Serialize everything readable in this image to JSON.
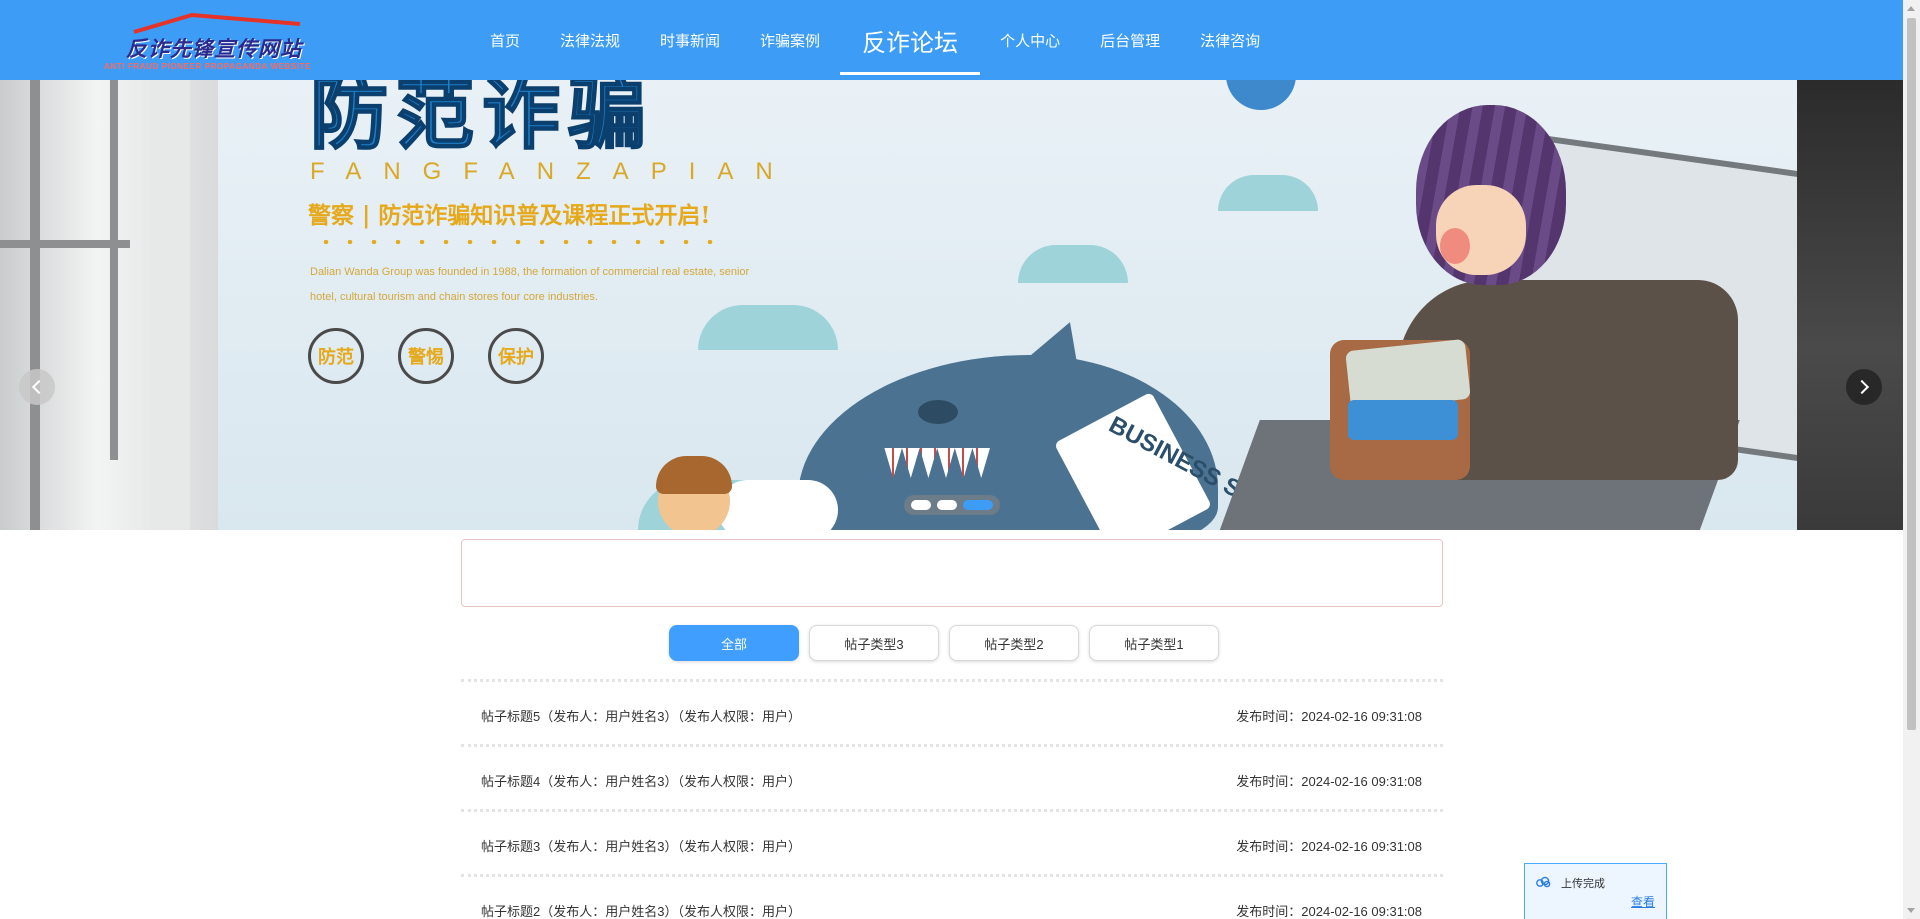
{
  "logo": {
    "title": "反诈先锋宣传网站",
    "subtitle": "ANTI FRAUD PIONEER PROPAGANDA WEBSITE"
  },
  "nav": {
    "items": [
      {
        "label": "首页"
      },
      {
        "label": "法律法规"
      },
      {
        "label": "时事新闻"
      },
      {
        "label": "诈骗案例"
      },
      {
        "label": "反诈论坛",
        "active": true
      },
      {
        "label": "个人中心"
      },
      {
        "label": "后台管理"
      },
      {
        "label": "法律咨询"
      }
    ]
  },
  "banner": {
    "spelling": "FANGFANZAPIAN",
    "slogan": "警察 | 防范诈骗知识普及课程正式开启!",
    "english_line1": "Dalian Wanda Group was founded in 1988, the formation of commercial real estate, senior",
    "english_line2": "hotel, cultural tourism and chain stores four core industries.",
    "badges": [
      "防范",
      "警惕",
      "保护"
    ],
    "shark_label": "BUSINESS SHARK",
    "active_slide": 3,
    "slide_count": 3
  },
  "filter_tabs": [
    {
      "label": "全部",
      "active": true
    },
    {
      "label": "帖子类型3"
    },
    {
      "label": "帖子类型2"
    },
    {
      "label": "帖子类型1"
    }
  ],
  "posts": [
    {
      "title": "帖子标题5（发布人：用户姓名3）（发布人权限：用户）",
      "time": "发布时间：2024-02-16 09:31:08"
    },
    {
      "title": "帖子标题4（发布人：用户姓名3）（发布人权限：用户）",
      "time": "发布时间：2024-02-16 09:31:08"
    },
    {
      "title": "帖子标题3（发布人：用户姓名3）（发布人权限：用户）",
      "time": "发布时间：2024-02-16 09:31:08"
    },
    {
      "title": "帖子标题2（发布人：用户姓名3）（发布人权限：用户）",
      "time": "发布时间：2024-02-16 09:31:08"
    }
  ],
  "upload_toast": {
    "status": "上传完成",
    "view_link": "查看"
  },
  "colors": {
    "header": "#3d9cf6",
    "active_tab": "#409eff",
    "search_border": "#e7c6c1",
    "toast_border": "#4aa8ff"
  }
}
